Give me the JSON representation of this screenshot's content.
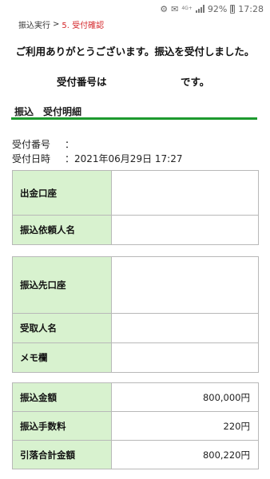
{
  "status_bar": {
    "battery": "92%",
    "time": "17:28",
    "network": "4G+"
  },
  "breadcrumb": {
    "prev": "振込実行",
    "separator": ">",
    "current": "5. 受付確認"
  },
  "heading": {
    "thanks": "ご利用ありがとうございます。振込を受付しました。",
    "receipt_label": "受付番号は",
    "receipt_suffix": "です。"
  },
  "section": {
    "title": "振込　受付明細"
  },
  "info": {
    "number_key": "受付番号",
    "number_value": "：",
    "datetime_key": "受付日時",
    "datetime_value": "：2021年06月29日 17:27"
  },
  "account_table": [
    {
      "label": "出金口座",
      "value": ""
    },
    {
      "label": "振込依頼人名",
      "value": ""
    }
  ],
  "payee_table": [
    {
      "label": "振込先口座",
      "value": ""
    },
    {
      "label": "受取人名",
      "value": ""
    },
    {
      "label": "メモ欄",
      "value": ""
    }
  ],
  "amount_table": [
    {
      "label": "振込金額",
      "value": "800,000円"
    },
    {
      "label": "振込手数料",
      "value": "220円"
    },
    {
      "label": "引落合計金額",
      "value": "800,220円"
    }
  ],
  "colors": {
    "accent_green": "#1d9a2e",
    "label_bg": "#d8f2cf",
    "breadcrumb_current": "#d4262a"
  }
}
